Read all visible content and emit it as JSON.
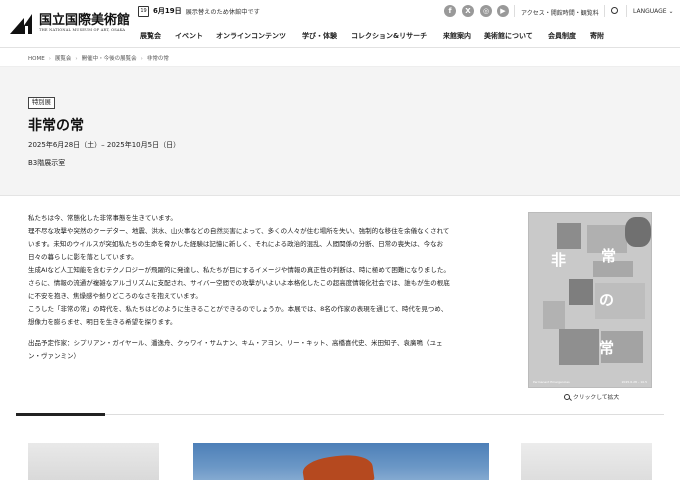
{
  "header": {
    "logo_jp": "国立国際美術館",
    "logo_en": "THE NATIONAL MUSEUM OF ART, OSAKA",
    "notice_cal": "19",
    "notice_date": "6月19日",
    "notice_text": "展示替えのため休館中です",
    "social": [
      {
        "icon": "facebook-icon",
        "glyph": "f"
      },
      {
        "icon": "x-icon",
        "glyph": "X"
      },
      {
        "icon": "instagram-icon",
        "glyph": "◎"
      },
      {
        "icon": "youtube-icon",
        "glyph": "▶"
      }
    ],
    "access_link": "アクセス・開館時間・観覧料",
    "language": "LANGUAGE",
    "nav": [
      "展覧会",
      "イベント",
      "オンラインコンテンツ",
      "学び・体験",
      "コレクション&リサーチ",
      "来館案内",
      "美術館について",
      "会員制度",
      "寄附"
    ]
  },
  "breadcrumb": [
    "HOME",
    "展覧会",
    "開催中・今後の展覧会",
    "非常の常"
  ],
  "hero": {
    "badge": "特別展",
    "title": "非常の常",
    "dates": "2025年6月28日（土）– 2025年10月5日（日）",
    "venue": "B3階展示室"
  },
  "body": {
    "paragraphs": [
      "私たちは今、常態化した非常事態を生きています。",
      "理不尽な攻撃や突然のクーデター、地震、洪水、山火事などの自然災害によって、多くの人々が住む場所を失い、強制的な移住を余儀なくされて",
      "います。未知のウイルスが突如私たちの生命を脅かした経験は記憶に新しく、それによる政治的混乱、人間関係の分断、日常の喪失は、今なお",
      "日々の暮らしに影を落としています。",
      "生成AIなど人工知能を含むテクノロジーが飛躍的に発達し、私たちが目にするイメージや情報の真正性の判断は、時に極めて困難になりました。",
      "さらに、情報の流通が複雑なアルゴリズムに支配され、サイバー空間での攻撃がいよいよ本格化したこの超高度情報化社会では、誰もが生の根底",
      "に不安を抱き、焦燥感や拠りどころのなさを抱えています。",
      "こうした「非常の常」の時代を、私たちはどのように生きることができるのでしょうか。本展では、8名の作家の表現を通じて、時代を見つめ、",
      "想像力を膨らませ、明日を生きる希望を探ります。"
    ],
    "artists_line1": "出品予定作家：シプリアン・ガイヤール、潘逸舟、クゥワイ・サムナン、キム・アヨン、リー・キット、高橋喜代史、米田知子、袁廣鳴（ユェ",
    "artists_line2": "ン・ヴァンミン）"
  },
  "poster": {
    "chars": [
      "非",
      "常",
      "の",
      "常"
    ],
    "foot_left": "Permanent Emergencies",
    "foot_right": "2025.6.28 – 10.5",
    "zoom_label": "クリックして拡大"
  }
}
